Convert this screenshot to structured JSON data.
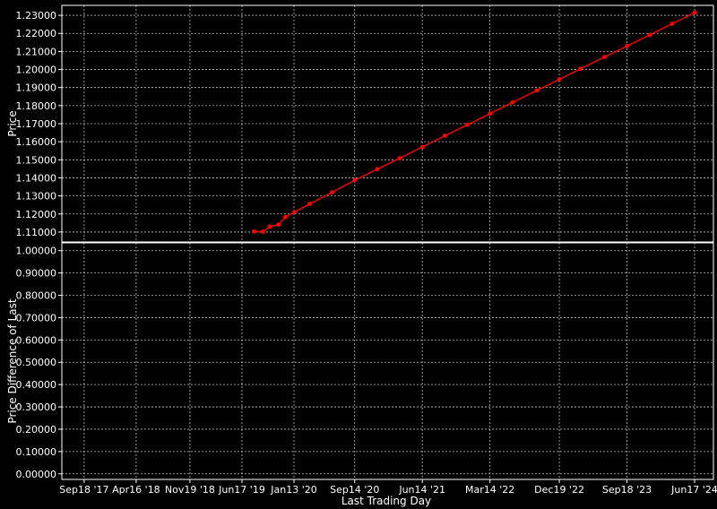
{
  "chart_data": {
    "type": "line",
    "xlabel": "Last Trading Day",
    "x_ticks": [
      "Sep18 '17",
      "Apr16 '18",
      "Nov19 '18",
      "Jun17 '19",
      "Jan13 '20",
      "Sep14 '20",
      "Jun14 '21",
      "Mar14 '22",
      "Dec19 '22",
      "Sep18 '23",
      "Jun17 '24"
    ],
    "x_tick_dates": [
      "2017-09-18",
      "2018-04-16",
      "2018-11-19",
      "2019-06-17",
      "2020-01-13",
      "2020-09-14",
      "2021-06-14",
      "2022-03-14",
      "2022-12-19",
      "2023-09-18",
      "2024-06-17"
    ],
    "xlim": [
      "2017-06-20",
      "2024-09-01"
    ],
    "panels": [
      {
        "id": "price",
        "ylabel": "Price",
        "ylim": [
          1.1045,
          1.2355
        ],
        "y_ticks": [
          "1.11000",
          "1.12000",
          "1.13000",
          "1.14000",
          "1.15000",
          "1.16000",
          "1.17000",
          "1.18000",
          "1.19000",
          "1.20000",
          "1.21000",
          "1.22000",
          "1.23000"
        ],
        "y_tick_values": [
          1.11,
          1.12,
          1.13,
          1.14,
          1.15,
          1.16,
          1.17,
          1.18,
          1.19,
          1.2,
          1.21,
          1.22,
          1.23
        ],
        "grid": true,
        "series": [
          {
            "color": "#ff0000",
            "points": [
              {
                "x": "2019-08-05",
                "y": 1.1103
              },
              {
                "x": "2019-09-09",
                "y": 1.1102
              },
              {
                "x": "2019-10-07",
                "y": 1.113
              },
              {
                "x": "2019-11-11",
                "y": 1.1141
              },
              {
                "x": "2019-12-09",
                "y": 1.1183
              },
              {
                "x": "2020-01-13",
                "y": 1.1209
              },
              {
                "x": "2020-03-16",
                "y": 1.1256
              },
              {
                "x": "2020-06-15",
                "y": 1.132
              },
              {
                "x": "2020-09-14",
                "y": 1.1387
              },
              {
                "x": "2020-12-14",
                "y": 1.1448
              },
              {
                "x": "2021-03-15",
                "y": 1.1509
              },
              {
                "x": "2021-06-14",
                "y": 1.1571
              },
              {
                "x": "2021-09-13",
                "y": 1.1633
              },
              {
                "x": "2021-12-13",
                "y": 1.1694
              },
              {
                "x": "2022-03-14",
                "y": 1.1756
              },
              {
                "x": "2022-06-13",
                "y": 1.1818
              },
              {
                "x": "2022-09-19",
                "y": 1.1884
              },
              {
                "x": "2022-12-19",
                "y": 1.1945
              },
              {
                "x": "2023-03-13",
                "y": 1.2003
              },
              {
                "x": "2023-06-19",
                "y": 1.2069
              },
              {
                "x": "2023-09-18",
                "y": 1.213
              },
              {
                "x": "2023-12-18",
                "y": 1.2191
              },
              {
                "x": "2024-03-18",
                "y": 1.2253
              },
              {
                "x": "2024-06-17",
                "y": 1.2315
              }
            ]
          }
        ]
      },
      {
        "id": "diff",
        "ylabel": "Price Difference of Last",
        "ylim": [
          -0.025,
          1.035
        ],
        "y_ticks": [
          "0.00000",
          "0.10000",
          "0.20000",
          "0.30000",
          "0.40000",
          "0.50000",
          "0.60000",
          "0.70000",
          "0.80000",
          "0.90000",
          "1.00000"
        ],
        "y_tick_values": [
          0,
          0.1,
          0.2,
          0.3,
          0.4,
          0.5,
          0.6,
          0.7,
          0.8,
          0.9,
          1.0
        ],
        "grid": true,
        "series": []
      }
    ]
  },
  "colors": {
    "background": "#000000",
    "axes": "#ffffff",
    "grid": "#bfbfbf",
    "text": "#ffffff",
    "series": "#ff0000"
  }
}
